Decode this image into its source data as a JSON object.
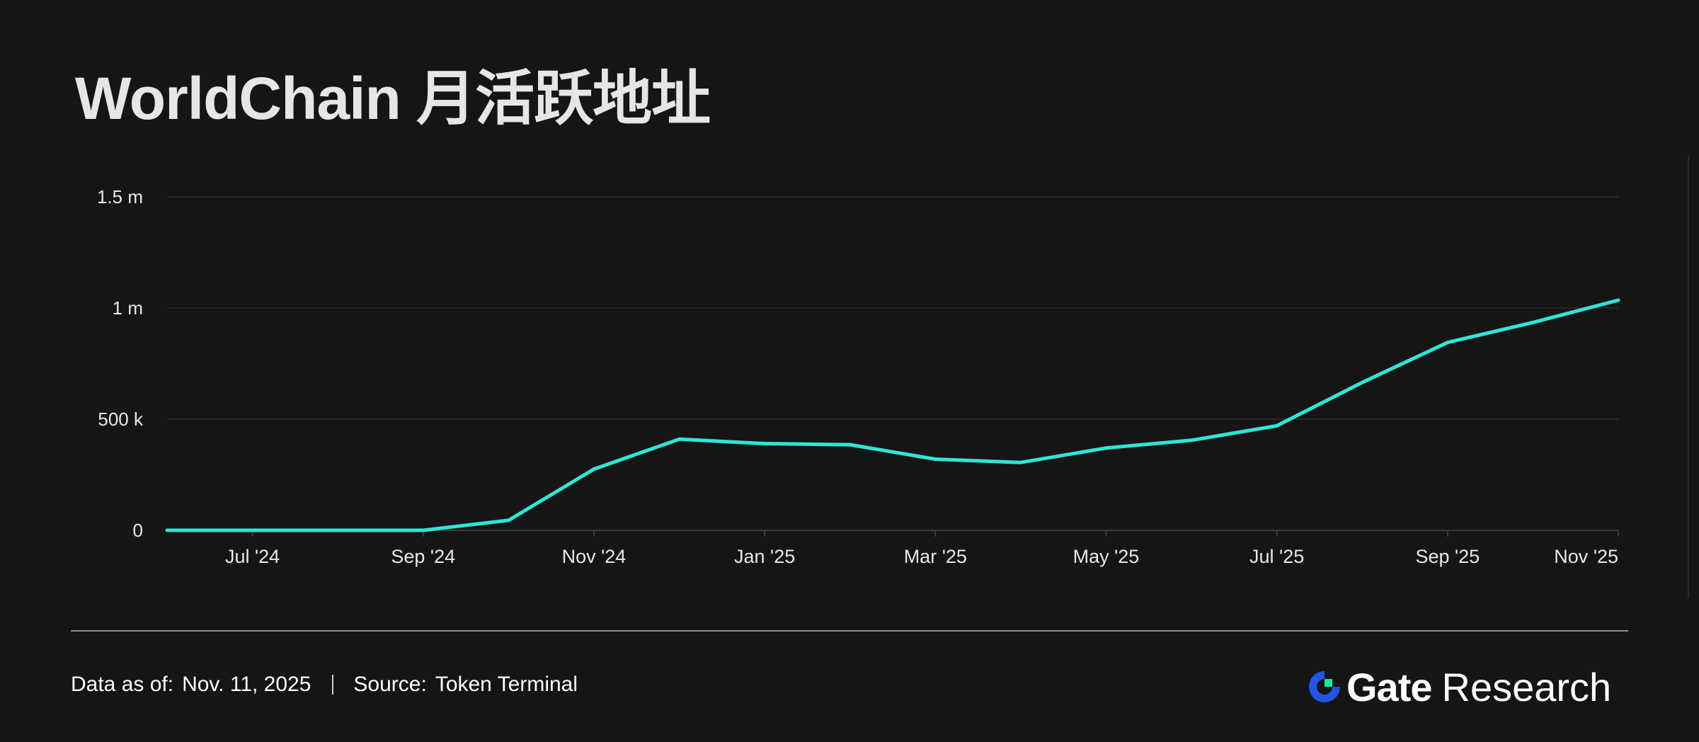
{
  "title": "WorldChain 月活跃地址",
  "footer": {
    "data_as_of_label": "Data as of:",
    "data_as_of_value": "Nov. 11, 2025",
    "source_label": "Source:",
    "source_value": "Token Terminal"
  },
  "brand": {
    "name": "Gate",
    "suffix": "Research",
    "logo_icon": "gate-logo-icon",
    "colors": {
      "blue": "#2354E6",
      "green": "#17E6A1"
    }
  },
  "chart_data": {
    "type": "line",
    "title": "WorldChain 月活跃地址",
    "xlabel": "",
    "ylabel": "",
    "line_color": "#2EE6D6",
    "grid": true,
    "y_ticks": [
      {
        "value": 0,
        "label": "0"
      },
      {
        "value": 500000,
        "label": "500 k"
      },
      {
        "value": 1000000,
        "label": "1 m"
      },
      {
        "value": 1500000,
        "label": "1.5 m"
      }
    ],
    "ylim": [
      0,
      1500000
    ],
    "x_range": [
      "2024-06",
      "2025-11"
    ],
    "x_ticks": [
      "Jul '24",
      "Sep '24",
      "Nov '24",
      "Jan '25",
      "Mar '25",
      "May '25",
      "Jul '25",
      "Sep '25",
      "Nov '25"
    ],
    "x_tick_months": [
      "2024-07",
      "2024-09",
      "2024-11",
      "2025-01",
      "2025-03",
      "2025-05",
      "2025-07",
      "2025-09",
      "2025-11"
    ],
    "series": [
      {
        "x": [
          "2024-06",
          "2024-07",
          "2024-08",
          "2024-09",
          "2024-10",
          "2024-11",
          "2024-12",
          "2025-01",
          "2025-02",
          "2025-03",
          "2025-04",
          "2025-05",
          "2025-06",
          "2025-07",
          "2025-08",
          "2025-09",
          "2025-10",
          "2025-11"
        ],
        "values": [
          0,
          0,
          0,
          0,
          45000,
          275000,
          410000,
          390000,
          385000,
          320000,
          305000,
          370000,
          405000,
          470000,
          665000,
          845000,
          935000,
          1035000
        ]
      }
    ]
  }
}
